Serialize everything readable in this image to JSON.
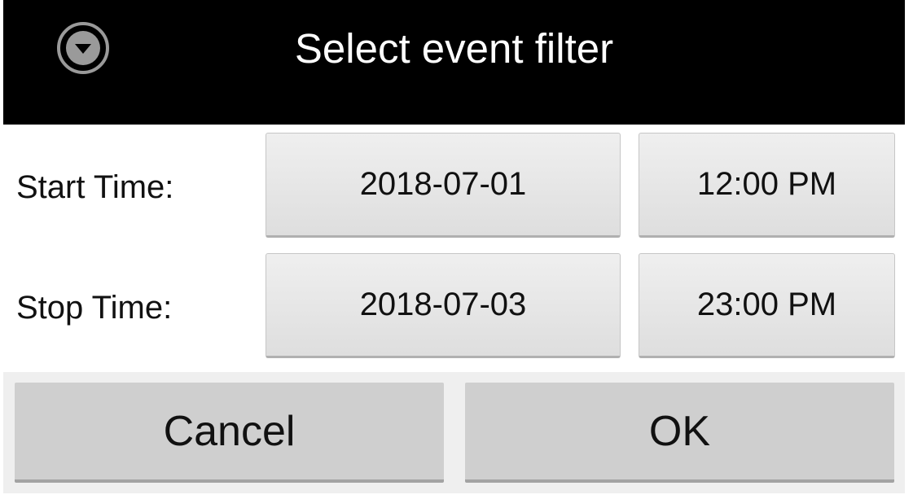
{
  "dialog": {
    "title": "Select event filter",
    "title_icon": "chevron-down-circle-icon"
  },
  "start": {
    "label": "Start Time:",
    "date": "2018-07-01",
    "time": "12:00 PM"
  },
  "stop": {
    "label": "Stop Time:",
    "date": "2018-07-03",
    "time": "23:00 PM"
  },
  "actions": {
    "cancel_label": "Cancel",
    "ok_label": "OK"
  },
  "colors": {
    "titlebar": "#000000",
    "title_text": "#ffffff",
    "field_button": "#e6e6e6",
    "action_button": "#cfcfcf"
  }
}
